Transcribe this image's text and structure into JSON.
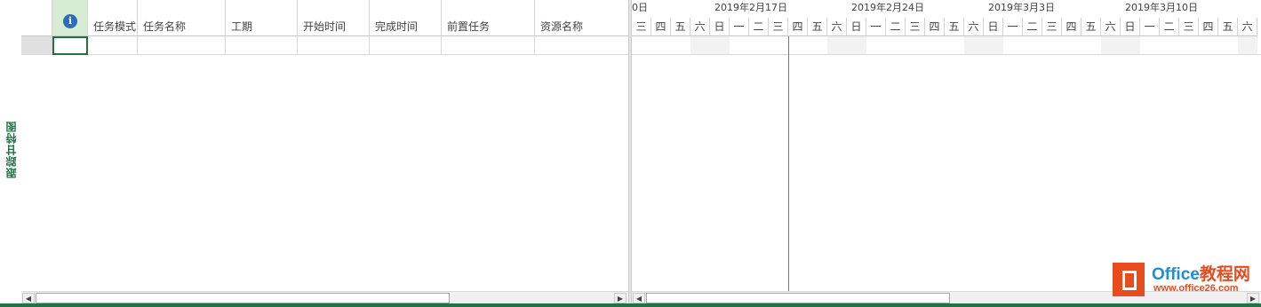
{
  "view_label": "跟踪甘特图",
  "table": {
    "columns": [
      "任务模式",
      "任务名称",
      "工期",
      "开始时间",
      "完成时间",
      "前置任务",
      "资源名称"
    ],
    "info_icon": "info-icon"
  },
  "gantt": {
    "weeks": [
      "0日",
      "2019年2月17日",
      "2019年2月24日",
      "2019年3月3日",
      "2019年3月10日"
    ],
    "days": [
      "三",
      "四",
      "五",
      "六",
      "日",
      "一",
      "二",
      "三",
      "四",
      "五",
      "六",
      "日",
      "一",
      "二",
      "三",
      "四",
      "五",
      "六",
      "日",
      "一",
      "二",
      "三",
      "四",
      "五",
      "六",
      "日",
      "一",
      "二",
      "三",
      "四",
      "五",
      "六"
    ]
  },
  "watermark": {
    "title_prefix": "Office",
    "title_suffix": "教程网",
    "url": "www.office26.com"
  },
  "colors": {
    "accent": "#217346",
    "today_line": "#3e9b57",
    "logo": "#e84c1e"
  }
}
